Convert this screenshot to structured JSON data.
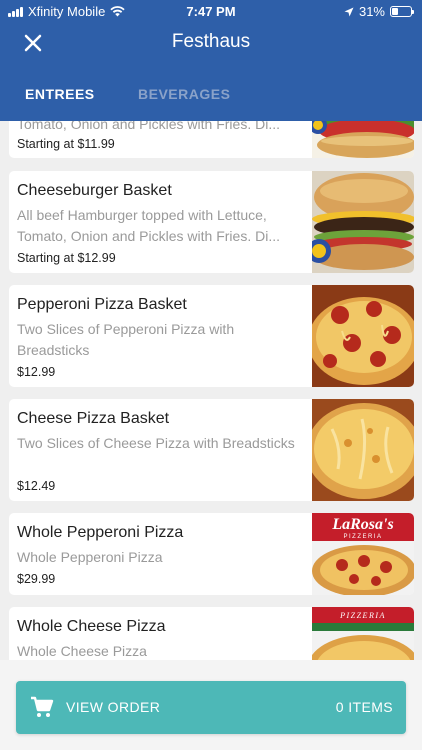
{
  "status_bar": {
    "carrier": "Xfinity Mobile",
    "time": "7:47 PM",
    "battery": "31%",
    "battery_level": 0.31,
    "icons": [
      "signal-icon",
      "wifi-icon",
      "location-arrow-icon",
      "battery-icon"
    ]
  },
  "header": {
    "title": "Festhaus",
    "close_icon": "close-icon"
  },
  "tabs": [
    {
      "label": "ENTREES",
      "active": true
    },
    {
      "label": "BEVERAGES",
      "active": false
    }
  ],
  "menu_items": [
    {
      "name": "",
      "description": "Tomato, Onion and Pickles with Fries.  Di...",
      "price": "Starting at $11.99",
      "image": "hamburger-image"
    },
    {
      "name": "Cheeseburger Basket",
      "description": "All beef Hamburger topped with Lettuce, Tomato, Onion and Pickles with Fries.  Di...",
      "price": "Starting at $12.99",
      "image": "cheeseburger-image"
    },
    {
      "name": "Pepperoni Pizza Basket",
      "description": "Two Slices of Pepperoni Pizza with Breadsticks",
      "price": "$12.99",
      "image": "pepperoni-pizza-image"
    },
    {
      "name": "Cheese Pizza Basket",
      "description": "Two Slices of Cheese Pizza with Breadsticks",
      "price": "$12.49",
      "image": "cheese-pizza-image"
    },
    {
      "name": "Whole Pepperoni Pizza",
      "description": "Whole Pepperoni Pizza",
      "price": "$29.99",
      "image": "larosas-pepperoni-pizza-image",
      "logo_text": "LaRosa's",
      "logo_subtext": "PIZZERIA"
    },
    {
      "name": "Whole Cheese Pizza",
      "description": "Whole Cheese Pizza",
      "price": "",
      "image": "larosas-cheese-pizza-image",
      "logo_text": "PIZZERIA"
    }
  ],
  "footer": {
    "view_order_label": "VIEW ORDER",
    "items_count": "0 ITEMS",
    "cart_icon": "cart-icon"
  },
  "colors": {
    "header": "#2e5fa9",
    "accent": "#4db8b7",
    "inactive_tab": "#8aa2c9"
  }
}
